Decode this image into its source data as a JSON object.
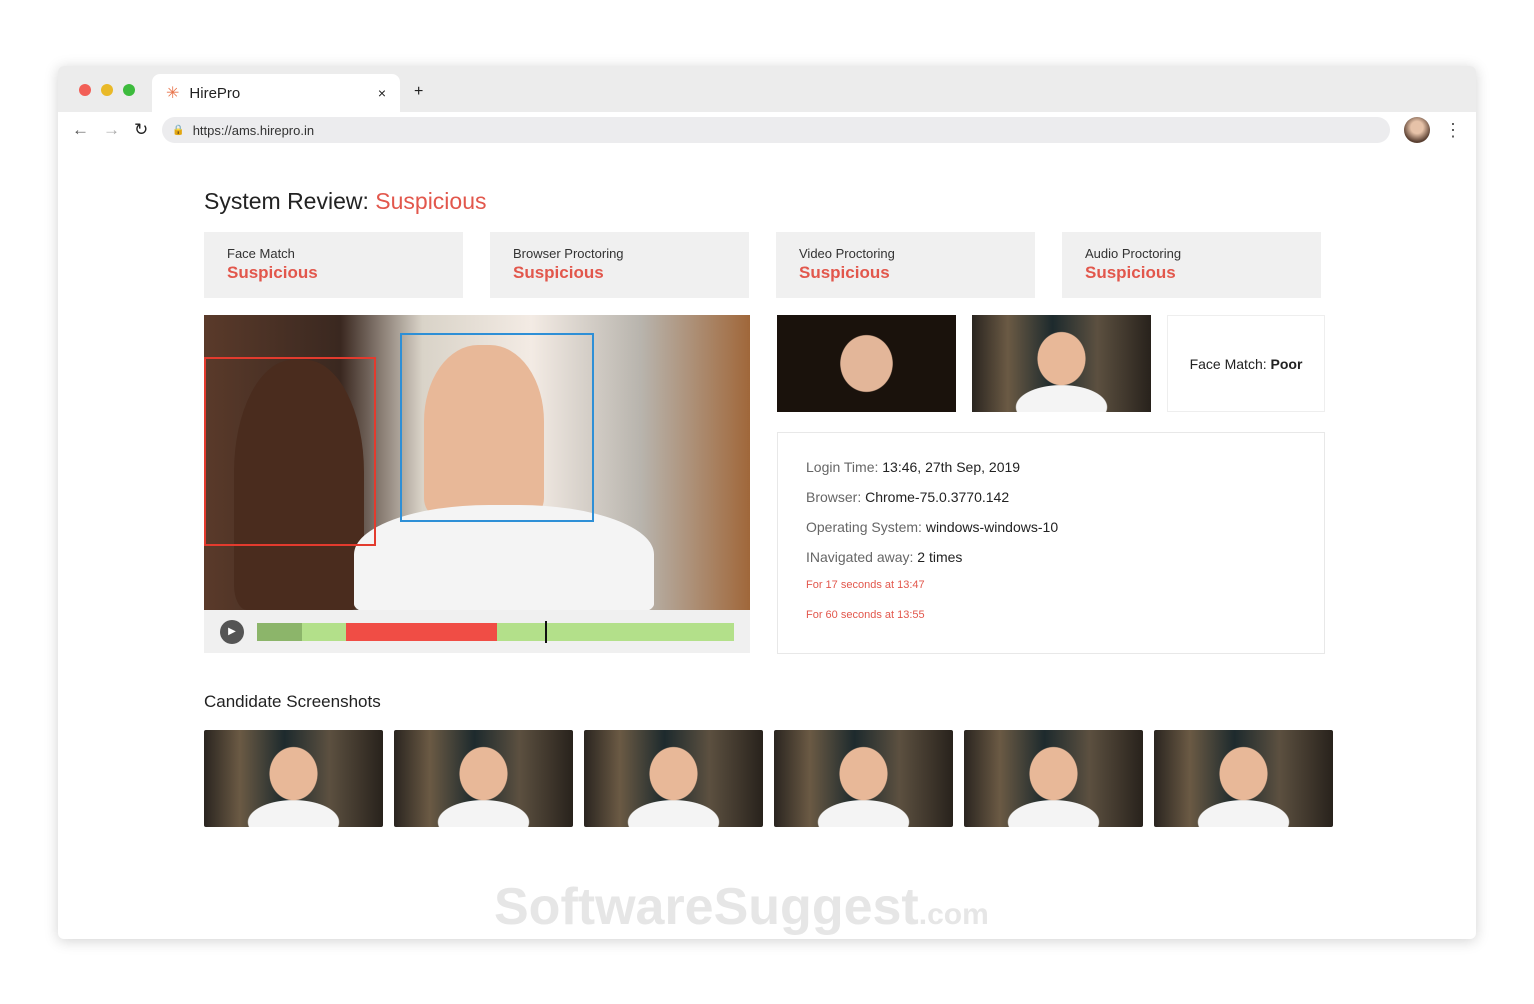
{
  "browser": {
    "tab_title": "HirePro",
    "url": "https://ams.hirepro.in",
    "close_icon": "×",
    "new_tab": "+"
  },
  "page": {
    "title_prefix": "System Review:",
    "title_status": "Suspicious"
  },
  "cards": [
    {
      "label": "Face Match",
      "value": "Suspicious"
    },
    {
      "label": "Browser Proctoring",
      "value": "Suspicious"
    },
    {
      "label": "Video Proctoring",
      "value": "Suspicious"
    },
    {
      "label": "Audio Proctoring",
      "value": "Suspicious"
    }
  ],
  "timeline": {
    "segments": [
      {
        "status": "reviewed",
        "percent": 9.5,
        "color": "#8cb56a"
      },
      {
        "status": "ok",
        "percent": 9.2,
        "color": "#b3e08a"
      },
      {
        "status": "suspicious",
        "percent": 31.7,
        "color": "#f04d45"
      },
      {
        "status": "ok",
        "percent": 49.6,
        "color": "#b3e08a"
      }
    ],
    "playhead_percent": 60.3
  },
  "face_match": {
    "label": "Face Match:",
    "value": "Poor"
  },
  "info": [
    {
      "key": "Login Time:",
      "value": "13:46, 27th Sep, 2019"
    },
    {
      "key": "Browser:",
      "value": "Chrome-75.0.3770.142"
    },
    {
      "key": "Operating System:",
      "value": "windows-windows-10"
    },
    {
      "key": "INavigated away:",
      "value": "2 times"
    }
  ],
  "navigations": [
    "For 17 seconds at 13:47",
    "For 60 seconds at 13:55"
  ],
  "screenshots": {
    "title": "Candidate Screenshots",
    "count": 6
  },
  "watermark": {
    "main": "SoftwareSuggest",
    "suffix": ".com"
  }
}
